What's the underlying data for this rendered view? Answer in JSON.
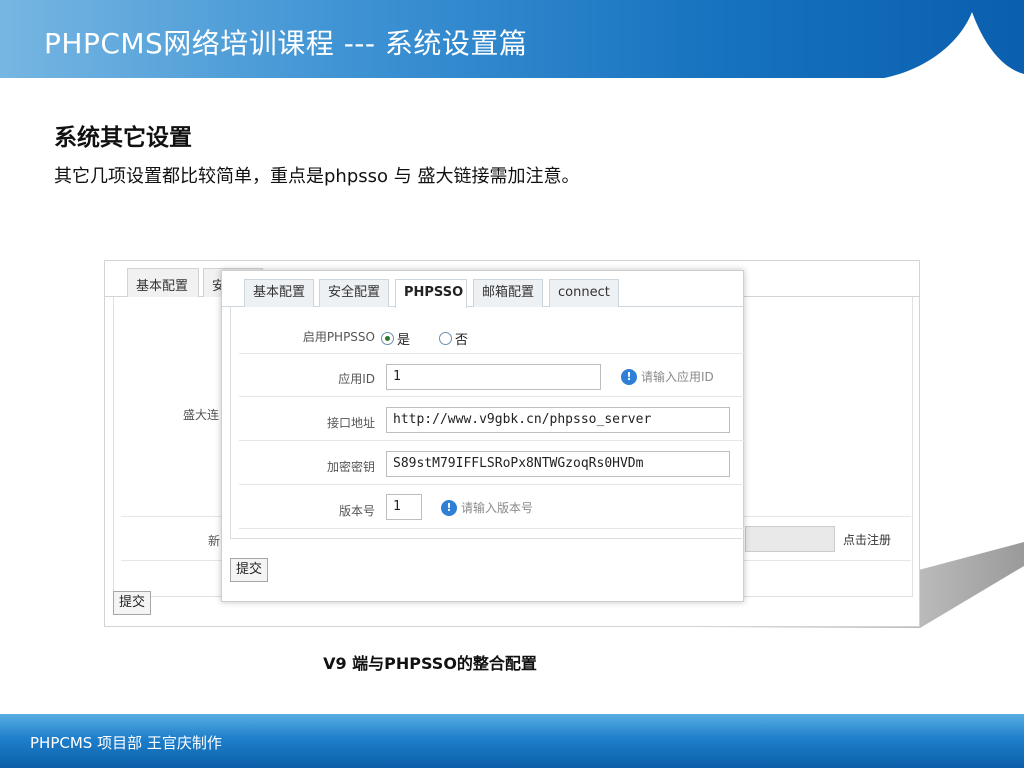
{
  "header": {
    "title": "PHPCMS网络培训课程 ---  系统设置篇"
  },
  "section": {
    "title": "系统其它设置",
    "description": "其它几项设置都比较简单，重点是phpsso 与 盛大链接需加注意。"
  },
  "background_panel": {
    "tabs": [
      "基本配置",
      "安"
    ],
    "label_shanda": "盛大连",
    "label_new": "新",
    "register_link": "点击注册",
    "submit_label": "提交"
  },
  "front_panel": {
    "tabs": [
      {
        "label": "基本配置",
        "active": false
      },
      {
        "label": "安全配置",
        "active": false
      },
      {
        "label": "PHPSSO",
        "active": true
      },
      {
        "label": "邮箱配置",
        "active": false
      },
      {
        "label": "connect",
        "active": false
      }
    ],
    "enable": {
      "label": "启用PHPSSO",
      "yes": "是",
      "no": "否",
      "selected": "是"
    },
    "app_id": {
      "label": "应用ID",
      "value": "1",
      "hint": "请输入应用ID"
    },
    "api_url": {
      "label": "接口地址",
      "value": "http://www.v9gbk.cn/phpsso_server"
    },
    "secret": {
      "label": "加密密钥",
      "value": "S89stM79IFFLSRoPx8NTWGzoqRs0HVDm"
    },
    "version": {
      "label": "版本号",
      "value": "1",
      "hint": "请输入版本号"
    },
    "submit_label": "提交"
  },
  "caption": "V9 端与PHPSSO的整合配置",
  "footer": {
    "text": "PHPCMS 项目部 王官庆制作"
  },
  "colors": {
    "header_blue": "#1772bf",
    "info_blue": "#2f7fd6",
    "footer_blue": "#1f7fcb"
  }
}
